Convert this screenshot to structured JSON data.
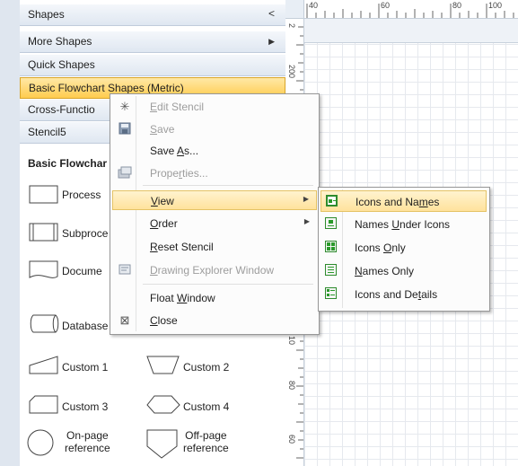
{
  "pane": {
    "headers": [
      {
        "label": "Shapes",
        "chevron": "<"
      },
      {
        "label": "More Shapes",
        "chevron": "▶"
      },
      {
        "label": "Quick Shapes"
      },
      {
        "label": "Basic Flowchart Shapes (Metric)"
      },
      {
        "label": "Cross-Functio"
      },
      {
        "label": "Stencil5"
      }
    ],
    "stencil_title": "Basic Flowchar",
    "shapes": [
      {
        "label": "Process"
      },
      {
        "label": "Subproce"
      },
      {
        "label": "Docume"
      },
      {
        "label": "Database"
      },
      {
        "label": "Custom 1"
      },
      {
        "label": "Custom 2"
      },
      {
        "label": "Custom 3"
      },
      {
        "label": "Custom 4"
      },
      {
        "label_line1": "On-page",
        "label_line2": "reference"
      },
      {
        "label_line1": "Off-page",
        "label_line2": "reference"
      }
    ]
  },
  "ruler": {
    "h": [
      "40",
      "60",
      "80",
      "100"
    ],
    "v": [
      "2",
      "200",
      "10",
      "80",
      "60"
    ]
  },
  "menu": {
    "items": [
      {
        "pre": "",
        "u": "E",
        "post": "dit Stencil",
        "icon": "sparkle-icon",
        "disabled": true
      },
      {
        "pre": "",
        "u": "S",
        "post": "ave",
        "icon": "floppy-disk-icon",
        "disabled": true
      },
      {
        "pre": "Save ",
        "u": "A",
        "post": "s...",
        "disabled": false
      },
      {
        "pre": "Prope",
        "u": "r",
        "post": "ties...",
        "icon": "properties-icon",
        "disabled": true
      },
      {
        "pre": "",
        "u": "V",
        "post": "iew",
        "disabled": false,
        "submenu": true
      },
      {
        "pre": "",
        "u": "O",
        "post": "rder",
        "disabled": false,
        "submenu": true
      },
      {
        "pre": "",
        "u": "R",
        "post": "eset Stencil",
        "disabled": false
      },
      {
        "pre": "",
        "u": "D",
        "post": "rawing Explorer Window",
        "icon": "drawing-explorer-icon",
        "disabled": true
      },
      {
        "pre": "Float ",
        "u": "W",
        "post": "indow",
        "disabled": false
      },
      {
        "pre": "",
        "u": "C",
        "post": "lose",
        "icon": "close-icon",
        "disabled": false
      }
    ]
  },
  "view_submenu": {
    "items": [
      {
        "pre": "Icons and Na",
        "u": "m",
        "post": "es",
        "icon": "icons-and-names-icon",
        "active": true
      },
      {
        "pre": "Names ",
        "u": "U",
        "post": "nder Icons",
        "icon": "names-under-icons-icon"
      },
      {
        "pre": "Icons ",
        "u": "O",
        "post": "nly",
        "icon": "icons-only-icon"
      },
      {
        "pre": "",
        "u": "N",
        "post": "ames Only",
        "icon": "names-only-icon"
      },
      {
        "pre": "Icons and De",
        "u": "t",
        "post": "ails",
        "icon": "icons-and-details-icon"
      }
    ]
  }
}
